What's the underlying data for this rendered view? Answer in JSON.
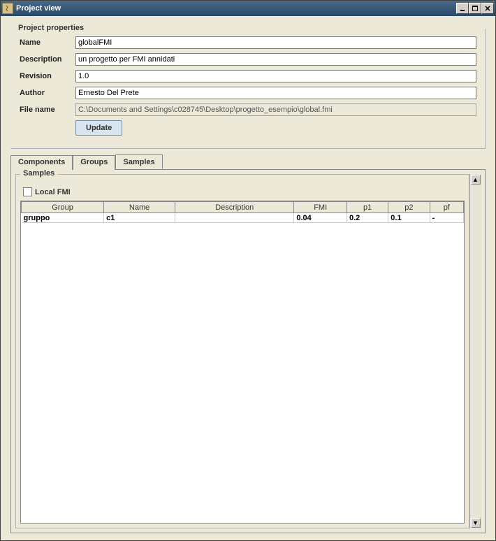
{
  "window": {
    "title": "Project view"
  },
  "properties": {
    "legend": "Project properties",
    "labels": {
      "name": "Name",
      "description": "Description",
      "revision": "Revision",
      "author": "Author",
      "filename": "File name"
    },
    "values": {
      "name": "globalFMI",
      "description": "un progetto per FMI annidati",
      "revision": "1.0",
      "author": "Ernesto Del Prete",
      "filename": "C:\\Documents and Settings\\c028745\\Desktop\\progetto_esempio\\global.fmi"
    },
    "update_label": "Update"
  },
  "tabs": {
    "components": "Components",
    "groups": "Groups",
    "samples": "Samples",
    "selected": "samples"
  },
  "samples": {
    "legend": "Samples",
    "local_fmi_label": "Local FMI",
    "local_fmi_checked": false,
    "columns": [
      "Group",
      "Name",
      "Description",
      "FMI",
      "p1",
      "p2",
      "pf"
    ],
    "rows": [
      {
        "group": "gruppo",
        "name": "c1",
        "description": "",
        "fmi": "0.04",
        "p1": "0.2",
        "p2": "0.1",
        "pf": "-"
      }
    ]
  }
}
